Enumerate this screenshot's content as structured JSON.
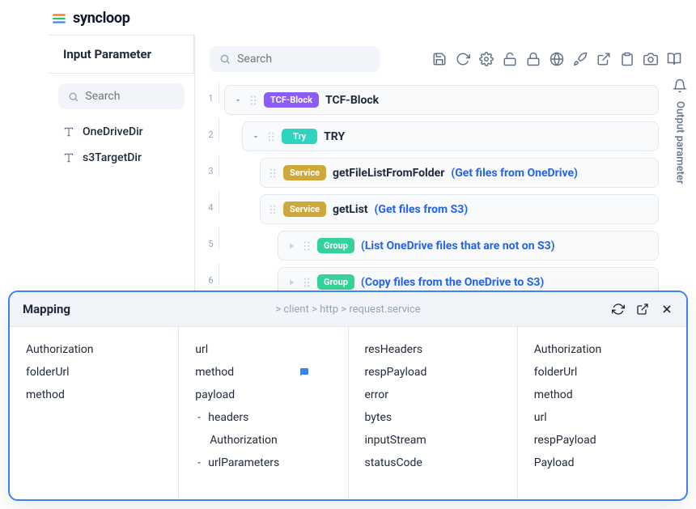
{
  "logo": {
    "text": "syncloop"
  },
  "sidebar": {
    "title": "Input Parameter",
    "search_placeholder": "Search",
    "params": [
      {
        "name": "OneDriveDir"
      },
      {
        "name": "s3TargetDir"
      }
    ]
  },
  "workspace": {
    "search_placeholder": "Search",
    "output_label": "Output parameter",
    "steps": [
      {
        "line": "1",
        "tag": "TCF-Block",
        "tag_style": "purple",
        "label": "TCF-Block",
        "indent": 0,
        "expandable": true
      },
      {
        "line": "2",
        "tag": "Try",
        "tag_style": "teal",
        "label": "TRY",
        "indent": 1,
        "expandable": true
      },
      {
        "line": "3",
        "tag": "Service",
        "tag_style": "service",
        "label": "getFileListFromFolder",
        "desc": "(Get files from OneDrive)",
        "indent": 2
      },
      {
        "line": "4",
        "tag": "Service",
        "tag_style": "service",
        "label": "getList",
        "desc": "(Get files from S3)",
        "indent": 2
      },
      {
        "line": "5",
        "tag": "Group",
        "tag_style": "green",
        "label": "",
        "desc": "(List OneDrive files that are not on S3)",
        "indent": 3,
        "playable": true
      },
      {
        "line": "6",
        "tag": "Group",
        "tag_style": "green",
        "label": "",
        "desc": "(Copy files from the OneDrive to S3)",
        "indent": 3,
        "playable": true
      }
    ]
  },
  "mapping": {
    "title": "Mapping",
    "breadcrumb": "> client > http > request.service",
    "col1": [
      {
        "label": "Authorization"
      },
      {
        "label": "folderUrl"
      },
      {
        "label": "method"
      }
    ],
    "col2": [
      {
        "label": "url"
      },
      {
        "label": "method",
        "marked": true
      },
      {
        "label": "payload"
      },
      {
        "label": "headers",
        "expandable": true
      },
      {
        "label": "Authorization",
        "indent": 1
      },
      {
        "label": "urlParameters",
        "expandable": true
      }
    ],
    "col3": [
      {
        "label": "resHeaders"
      },
      {
        "label": "respPayload"
      },
      {
        "label": "error"
      },
      {
        "label": "bytes"
      },
      {
        "label": "inputStream"
      },
      {
        "label": "statusCode"
      }
    ],
    "col4": [
      {
        "label": "Authorization"
      },
      {
        "label": "folderUrl"
      },
      {
        "label": "method"
      },
      {
        "label": "url"
      },
      {
        "label": "respPayload"
      },
      {
        "label": "Payload"
      }
    ]
  }
}
